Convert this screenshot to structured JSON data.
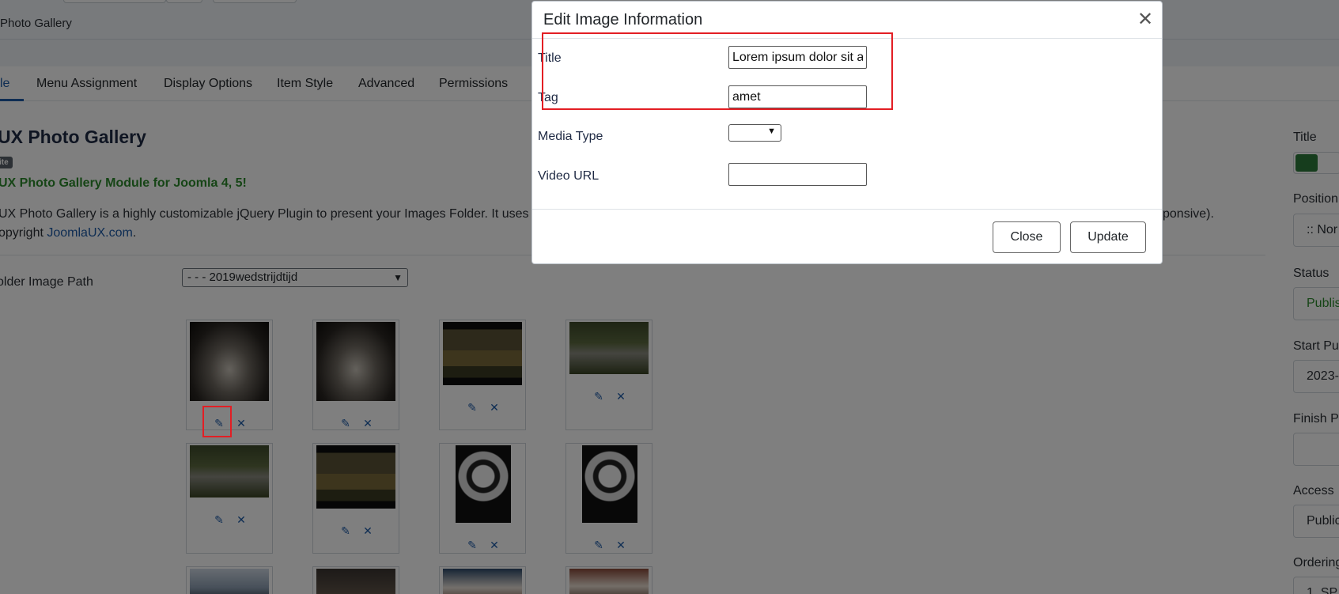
{
  "page": {
    "breadcrumb": "Photo Gallery",
    "tabs": [
      "le",
      "Menu Assignment",
      "Display Options",
      "Item Style",
      "Advanced",
      "Permissions"
    ],
    "module_title": "UX Photo Gallery",
    "badge": "ite",
    "module_subtitle": "UX Photo Gallery Module for Joomla 4, 5!",
    "description": "UX Photo Gallery is a highly customizable jQuery Plugin to present your Images Folder. It uses th",
    "description_tail": "ponsive).",
    "copyright_prefix": "opyright ",
    "copyright_link": "JoomlaUX.com",
    "copyright_suffix": ".",
    "folder_label": "older Image Path",
    "folder_value": "- - - 2019wedstrijdtijd",
    "right_panel": {
      "title_label": "Title",
      "position_label": "Position",
      "position_value": ":: Nor",
      "status_label": "Status",
      "status_value": "Publis",
      "start_label": "Start Pu",
      "start_value": "2023-",
      "finish_label": "Finish P",
      "access_label": "Access",
      "access_value": "Public",
      "ordering_label": "Ordering",
      "ordering_value": "1. SP"
    }
  },
  "modal": {
    "title": "Edit Image Information",
    "close_icon": "close-icon",
    "fields": {
      "title_label": "Title",
      "title_value": "Lorem ipsum dolor sit a",
      "tag_label": "Tag",
      "tag_value": "amet",
      "media_type_label": "Media Type",
      "media_type_value": "",
      "video_url_label": "Video URL",
      "video_url_value": ""
    },
    "buttons": {
      "close": "Close",
      "update": "Update"
    }
  },
  "icons": {
    "edit": "edit-icon",
    "delete": "delete-icon"
  },
  "colors": {
    "accent": "#1d5aa7",
    "highlight": "#e31e24",
    "success": "#2c8a2c"
  }
}
